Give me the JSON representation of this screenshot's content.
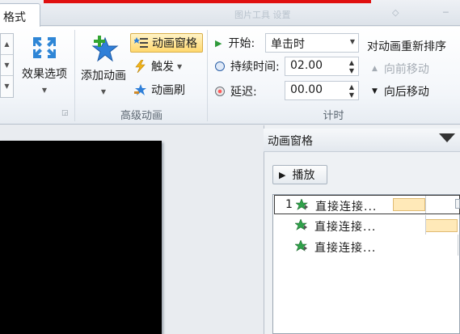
{
  "tabs": {
    "format": "格式",
    "faint_text": "图片工具 设置"
  },
  "ribbon": {
    "effects": {
      "label": "效果选项"
    },
    "advanced": {
      "add_animation": "添加动画",
      "pane_btn": "动画窗格",
      "trigger": "触发",
      "painter": "动画刷",
      "group_label": "高级动画"
    },
    "timing": {
      "start_label": "开始:",
      "start_value": "单击时",
      "duration_label": "持续时间:",
      "duration_value": "02.00",
      "delay_label": "延迟:",
      "delay_value": "00.00",
      "group_label": "计时"
    },
    "reorder": {
      "title": "对动画重新排序",
      "forward": "向前移动",
      "backward": "向后移动"
    }
  },
  "pane": {
    "title": "动画窗格",
    "play": "播放",
    "items": [
      {
        "num": "1",
        "label": "直接连接..."
      },
      {
        "num": "",
        "label": "直接连接..."
      },
      {
        "num": "",
        "label": "直接连接..."
      }
    ]
  },
  "colors": {
    "accent_red": "#e01010",
    "selected_gold": "#ffd86e",
    "timing_bar": "#ffe9b8"
  }
}
